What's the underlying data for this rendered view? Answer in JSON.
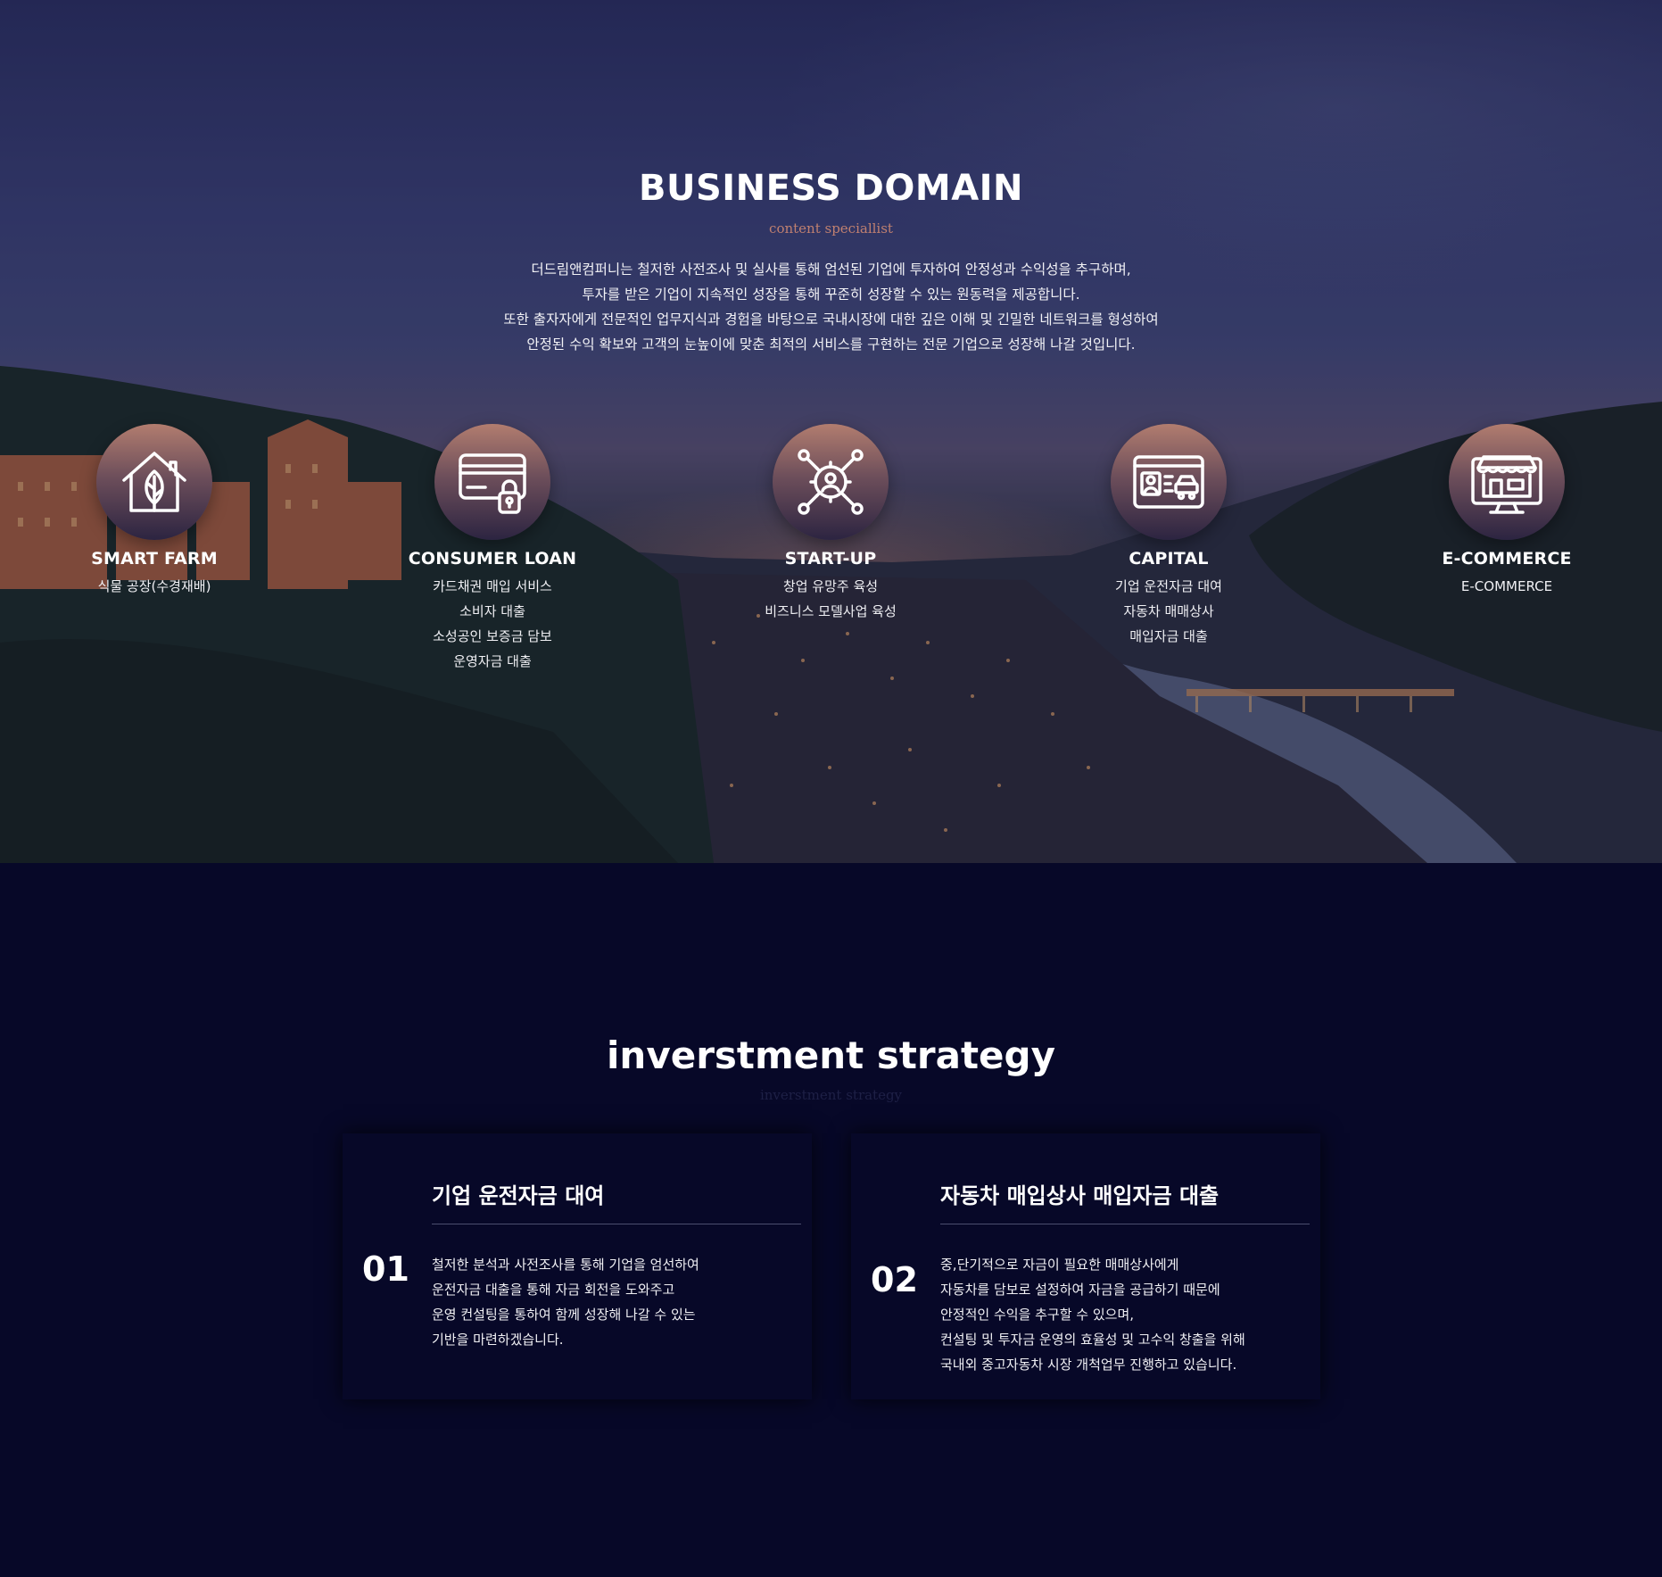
{
  "business_domain": {
    "title": "BUSINESS DOMAIN",
    "subtitle": "content speciallist",
    "description": [
      "더드림앤컴퍼니는 철저한 사전조사 및 실사를 통해 엄선된 기업에 투자하여 안정성과 수익성을 추구하며,",
      "투자를 받은 기업이 지속적인 성장을 통해 꾸준히 성장할 수 있는 원동력을 제공합니다.",
      "또한 출자자에게 전문적인 업무지식과 경험을 바탕으로 국내시장에 대한 깊은 이해 및 긴밀한 네트워크를 형성하여",
      "안정된 수익 확보와 고객의 눈높이에 맞춘 최적의 서비스를 구현하는 전문 기업으로 성장해 나갈 것입니다."
    ],
    "domains": [
      {
        "name": "SMART FARM",
        "icon": "smart-farm-house-leaf-icon",
        "items": [
          "식물 공장(수경재배)"
        ]
      },
      {
        "name": "CONSUMER LOAN",
        "icon": "credit-card-lock-icon",
        "items": [
          "카드채권 매입 서비스",
          "소비자 대출",
          "소성공인 보증금 담보",
          "운영자금 대출"
        ]
      },
      {
        "name": "START-UP",
        "icon": "gear-network-user-icon",
        "items": [
          "창업 유망주 육성",
          "비즈니스 모델사업 육성"
        ]
      },
      {
        "name": "CAPITAL",
        "icon": "id-card-car-icon",
        "items": [
          "기업 운전자금 대여",
          "자동차 매매상사",
          "매입자금 대출"
        ]
      },
      {
        "name": "E-COMMERCE",
        "icon": "online-store-monitor-icon",
        "items": [
          "E-COMMERCE"
        ]
      }
    ]
  },
  "strategy": {
    "title": "inverstment strategy",
    "subtitle": "inverstment strategy",
    "cards": [
      {
        "number": "01",
        "title": "기업 운전자금 대여",
        "lines": [
          "철저한 분석과 사전조사를 통해 기업을 엄선하여",
          "운전자금 대출을 통해 자금 회전을 도와주고",
          "운영 컨설팅을 통하여 함께 성장해 나갈 수 있는",
          "기반을 마련하겠습니다."
        ]
      },
      {
        "number": "02",
        "title": "자동차 매입상사 매입자금 대출",
        "lines": [
          "중,단기적으로 자금이 필요한 매매상사에게",
          "자동차를 담보로 설정하여 자금을 공급하기 때문에",
          "안정적인 수익을 추구할 수 있으며,",
          "컨설팅 및 투자금 운영의 효율성 및 고수익 창출을 위해",
          "국내외 중고자동차 시장 개척업무 진행하고 있습니다."
        ]
      }
    ]
  },
  "colors": {
    "page_background": "#070828",
    "accent_subtitle": "#c08070",
    "icon_circle_top": "#b27d6f",
    "icon_circle_bottom": "#2c2441"
  }
}
